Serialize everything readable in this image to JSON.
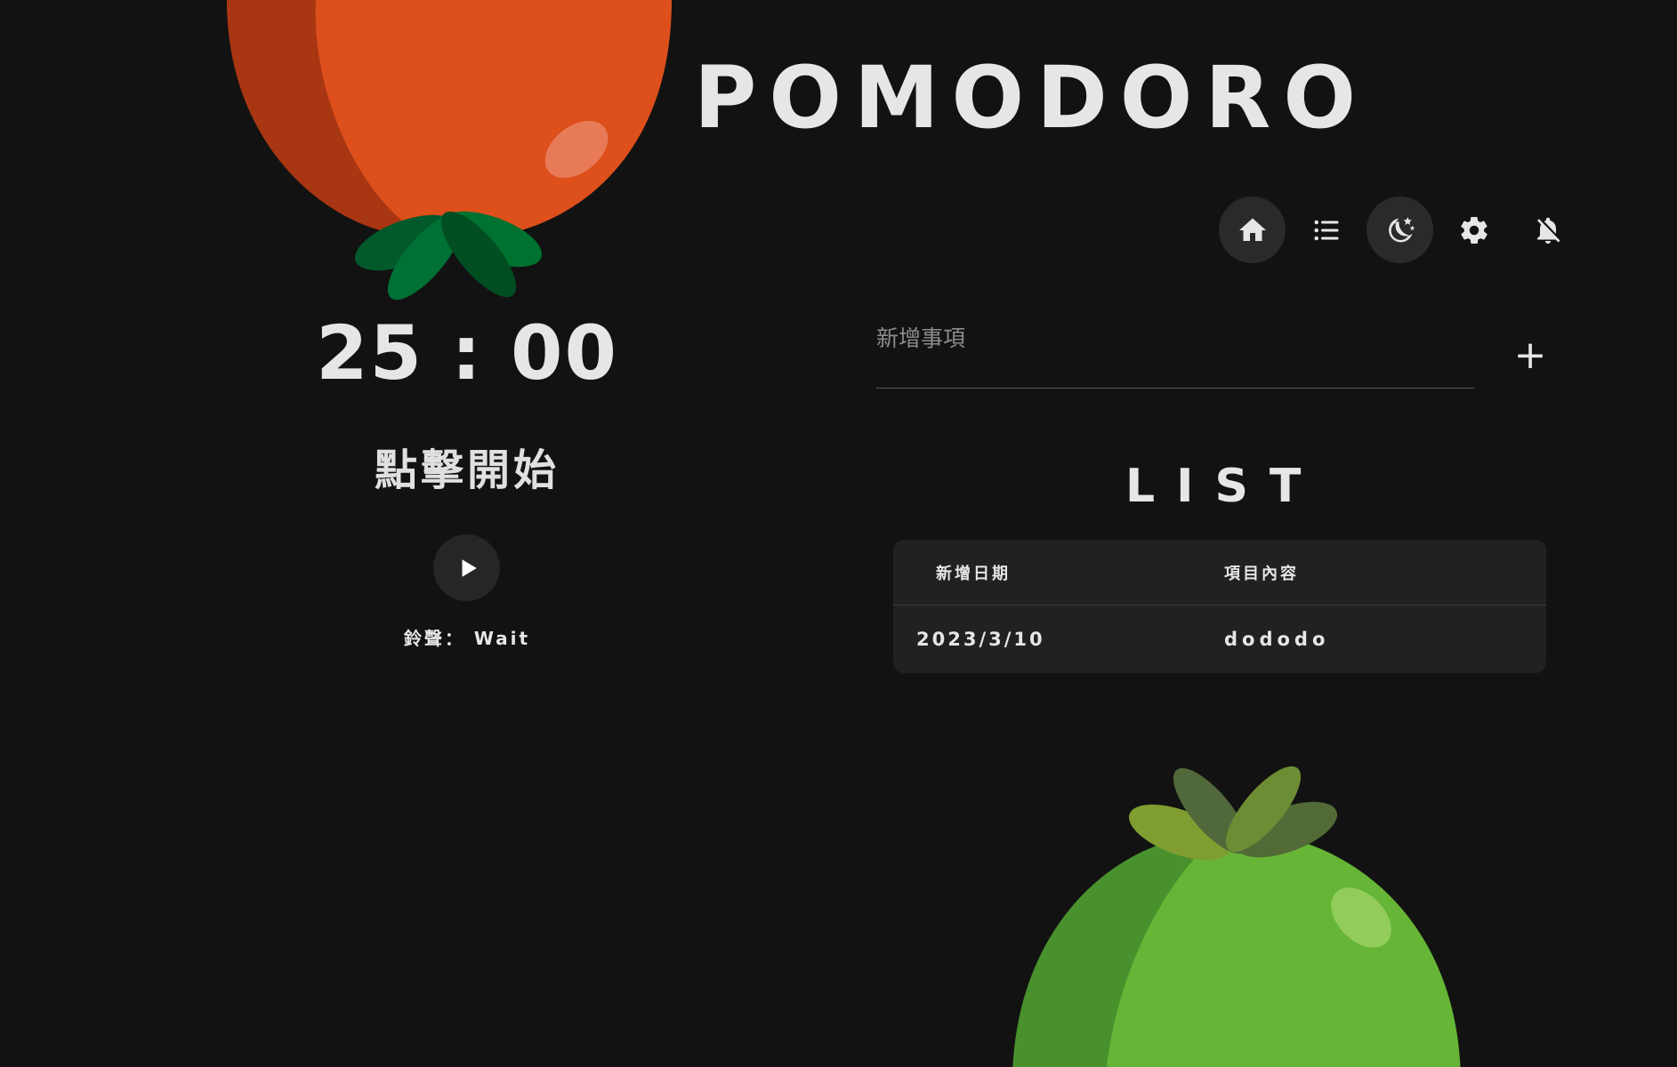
{
  "header": {
    "title": "POMODORO"
  },
  "nav": {
    "items": [
      {
        "icon": "home-icon",
        "active": true
      },
      {
        "icon": "list-icon",
        "active": false
      },
      {
        "icon": "dark-mode-icon",
        "active": true
      },
      {
        "icon": "settings-icon",
        "active": false
      },
      {
        "icon": "notifications-off-icon",
        "active": false
      }
    ]
  },
  "timer": {
    "display": "25 : 00",
    "status": "點擊開始",
    "ringtone": "鈴聲： Wait"
  },
  "todo": {
    "placeholder": "新增事項",
    "value": "",
    "add_label": "+"
  },
  "list": {
    "title": "LIST",
    "columns": [
      "新增日期",
      "項目內容"
    ],
    "rows": [
      {
        "date": "2023/3/10",
        "content": "dododo"
      }
    ]
  },
  "colors": {
    "background": "#121212",
    "tomato_red": "#dd4f1b",
    "tomato_green": "#66b536",
    "leaf_dark": "#00592b",
    "card": "#212121"
  }
}
